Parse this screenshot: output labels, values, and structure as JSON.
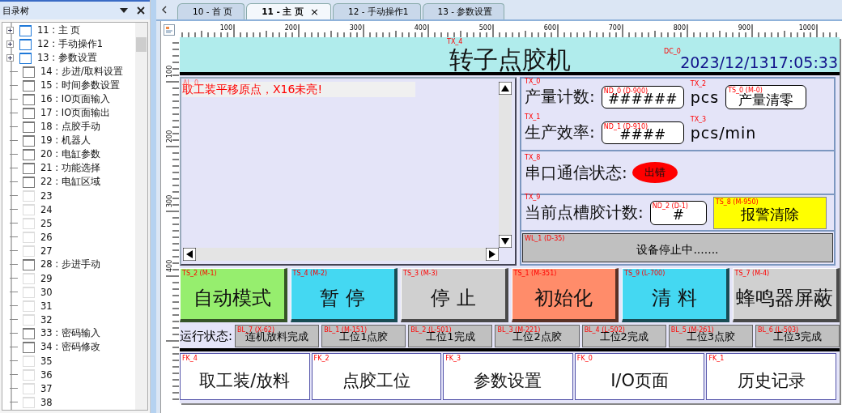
{
  "sidebar": {
    "title": "目录树",
    "items": [
      {
        "label": "11 : 主 页",
        "kind": "open",
        "has_children": true
      },
      {
        "label": "12 : 手动操作1",
        "kind": "open",
        "has_children": true
      },
      {
        "label": "13 : 参数设置",
        "kind": "open",
        "has_children": true
      },
      {
        "label": "14 : 步进/取料设置",
        "kind": "page",
        "has_children": false
      },
      {
        "label": "15 : 时间参数设置",
        "kind": "page",
        "has_children": false
      },
      {
        "label": "16 : IO页面输入",
        "kind": "page",
        "has_children": false
      },
      {
        "label": "17 : IO页面输出",
        "kind": "page",
        "has_children": false
      },
      {
        "label": "18 : 点胶手动",
        "kind": "page",
        "has_children": false
      },
      {
        "label": "19 : 机器人",
        "kind": "page",
        "has_children": false
      },
      {
        "label": "20 : 电缸参数",
        "kind": "page",
        "has_children": false
      },
      {
        "label": "21 : 功能选择",
        "kind": "page",
        "has_children": false
      },
      {
        "label": "22 : 电缸区域",
        "kind": "page",
        "has_children": false
      },
      {
        "label": "23",
        "kind": "blank",
        "has_children": false
      },
      {
        "label": "24",
        "kind": "blank",
        "has_children": false
      },
      {
        "label": "25",
        "kind": "blank",
        "has_children": false
      },
      {
        "label": "26",
        "kind": "blank",
        "has_children": false
      },
      {
        "label": "27",
        "kind": "blank",
        "has_children": false
      },
      {
        "label": "28 : 步进手动",
        "kind": "page",
        "has_children": false
      },
      {
        "label": "29",
        "kind": "blank",
        "has_children": false
      },
      {
        "label": "30",
        "kind": "blank",
        "has_children": false
      },
      {
        "label": "31",
        "kind": "blank",
        "has_children": false
      },
      {
        "label": "32",
        "kind": "blank",
        "has_children": false
      },
      {
        "label": "33 : 密码输入",
        "kind": "page",
        "has_children": false
      },
      {
        "label": "34 : 密码修改",
        "kind": "page",
        "has_children": false
      },
      {
        "label": "35",
        "kind": "blank",
        "has_children": false
      },
      {
        "label": "36",
        "kind": "blank",
        "has_children": false
      },
      {
        "label": "37",
        "kind": "blank",
        "has_children": false
      },
      {
        "label": "38",
        "kind": "blank",
        "has_children": false
      }
    ]
  },
  "tabs": [
    {
      "label": "10 - 首 页",
      "selected": false
    },
    {
      "label": "11 - 主 页",
      "selected": true,
      "close": "×"
    },
    {
      "label": "12 - 手动操作1",
      "selected": false
    },
    {
      "label": "13 - 参数设置",
      "selected": false
    }
  ],
  "ruler": {
    "horizontal": [
      "100",
      "200",
      "300",
      "400",
      "500",
      "600",
      "700",
      "800",
      "900",
      "1000"
    ],
    "vertical": [
      "100",
      "200",
      "300",
      "400"
    ]
  },
  "screen": {
    "title": {
      "tag": "TX_4",
      "text": "转子点胶机"
    },
    "clock": {
      "tag": "DC_0",
      "text": "2023/12/1317:05:33"
    },
    "alarm_list": {
      "tag": "AL_0",
      "message": "取工装平移原点，X16未亮!"
    },
    "counters": [
      {
        "label_tag": "TX_0",
        "label": "产量计数:",
        "field_tag": "ND_0 (D-900)",
        "value": "######",
        "unit_tag": "TX_2",
        "unit": "pcs",
        "button": {
          "tag": "TS_0 (M-0)",
          "label": "产量清零"
        }
      },
      {
        "label_tag": "TX_1",
        "label": "生产效率:",
        "field_tag": "ND_1 (D-910)",
        "value": "####",
        "unit_tag": "TX_3",
        "unit": "pcs/min"
      }
    ],
    "comm": {
      "label_tag": "TX_8",
      "label": "串口通信状态:",
      "status": "出错",
      "color": "#ff0000"
    },
    "glue": {
      "label_tag": "TX_9",
      "label": "当前点槽胶计数:",
      "field_tag": "ND_2 (D-1)",
      "value": "#",
      "button": {
        "tag": "TS_8 (M-950)",
        "label": "报警清除",
        "color": "#ffff00"
      }
    },
    "message": {
      "tag": "WL_1 (D-35)",
      "text": "设备停止中......."
    },
    "buttons": [
      {
        "tag": "TS_2 (M-1)",
        "label": "自动模式",
        "color": "#96ee6e"
      },
      {
        "tag": "TS_4 (M-2)",
        "label": "暂 停",
        "color": "#44d8f2"
      },
      {
        "tag": "TS_3 (M-3)",
        "label": "停 止",
        "color": "#d0d0d0"
      },
      {
        "tag": "TS_1 (M-351)",
        "label": "初始化",
        "color": "#ff8c6a"
      },
      {
        "tag": "TS_9 (L-700)",
        "label": "清 料",
        "color": "#44d8f2"
      },
      {
        "tag": "TS_7 (M-4)",
        "label": "蜂鸣器屏蔽",
        "color": "#d0d0d0"
      }
    ],
    "run_status": {
      "label": "运行状态:",
      "lamps": [
        {
          "tag": "BL_7 (X-62)",
          "label": "连机放料完成"
        },
        {
          "tag": "BL_1 (M-151)",
          "label": "工位1点胶"
        },
        {
          "tag": "BL_2 (L-501)",
          "label": "工位1完成"
        },
        {
          "tag": "BL_3 (M-221)",
          "label": "工位2点胶"
        },
        {
          "tag": "BL_4 (L-502)",
          "label": "工位2完成"
        },
        {
          "tag": "BL_5 (M-261)",
          "label": "工位3点胶"
        },
        {
          "tag": "BL_6 (L-503)",
          "label": "工位3完成"
        }
      ]
    },
    "nav": [
      {
        "tag": "FK_4",
        "label": "取工装/放料"
      },
      {
        "tag": "FK_2",
        "label": "点胶工位"
      },
      {
        "tag": "FK_3",
        "label": "参数设置"
      },
      {
        "tag": "FK_0",
        "label": "I/O页面"
      },
      {
        "tag": "FK_1",
        "label": "历史记录"
      }
    ]
  }
}
